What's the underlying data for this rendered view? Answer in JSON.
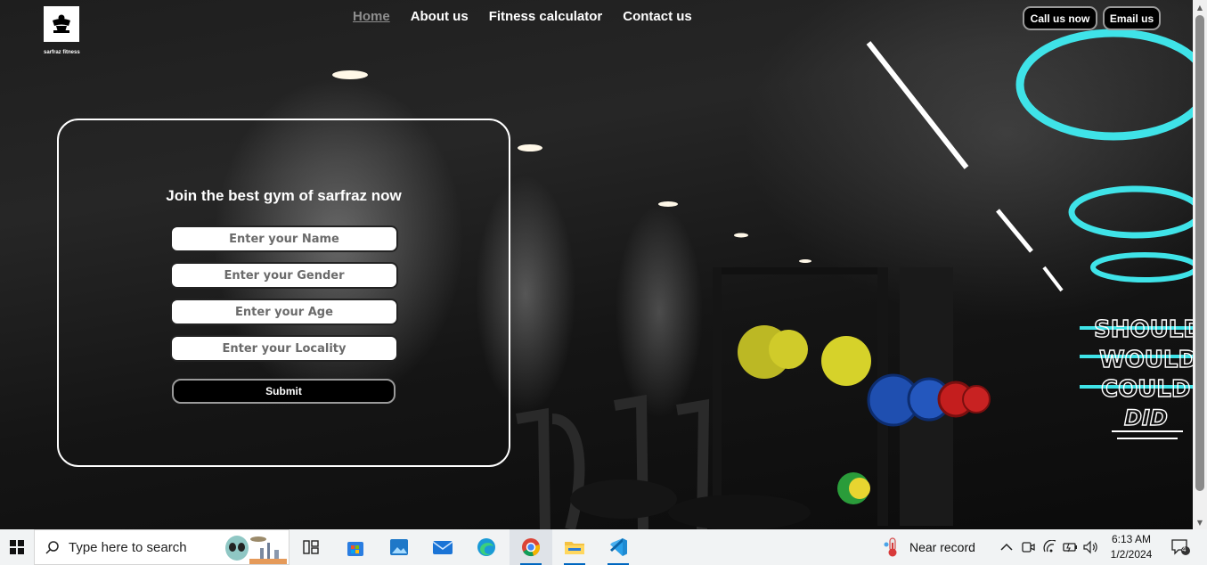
{
  "brand": {
    "caption": "sarfraz fitness"
  },
  "nav": {
    "items": [
      {
        "label": "Home",
        "active": true
      },
      {
        "label": "About us",
        "active": false
      },
      {
        "label": "Fitness calculator",
        "active": false
      },
      {
        "label": "Contact us",
        "active": false
      }
    ]
  },
  "header_buttons": {
    "call": "Call us now",
    "email": "Email us"
  },
  "form": {
    "title": "Join the best gym of sarfraz now",
    "name_placeholder": "Enter your Name",
    "gender_placeholder": "Enter your Gender",
    "age_placeholder": "Enter your Age",
    "locality_placeholder": "Enter your Locality",
    "submit_label": "Submit"
  },
  "neon_sign": {
    "lines": [
      "SHOULD",
      "WOULD",
      "COULD",
      "DID"
    ],
    "color": "#3fe3e8"
  },
  "taskbar": {
    "search_placeholder": "Type here to search",
    "weather": "Near record",
    "time": "6:13 AM",
    "date": "1/2/2024",
    "notification_count": "4",
    "apps": [
      "task-view",
      "microsoft-store",
      "photos",
      "mail",
      "edge",
      "chrome",
      "file-explorer",
      "vs-code"
    ]
  }
}
